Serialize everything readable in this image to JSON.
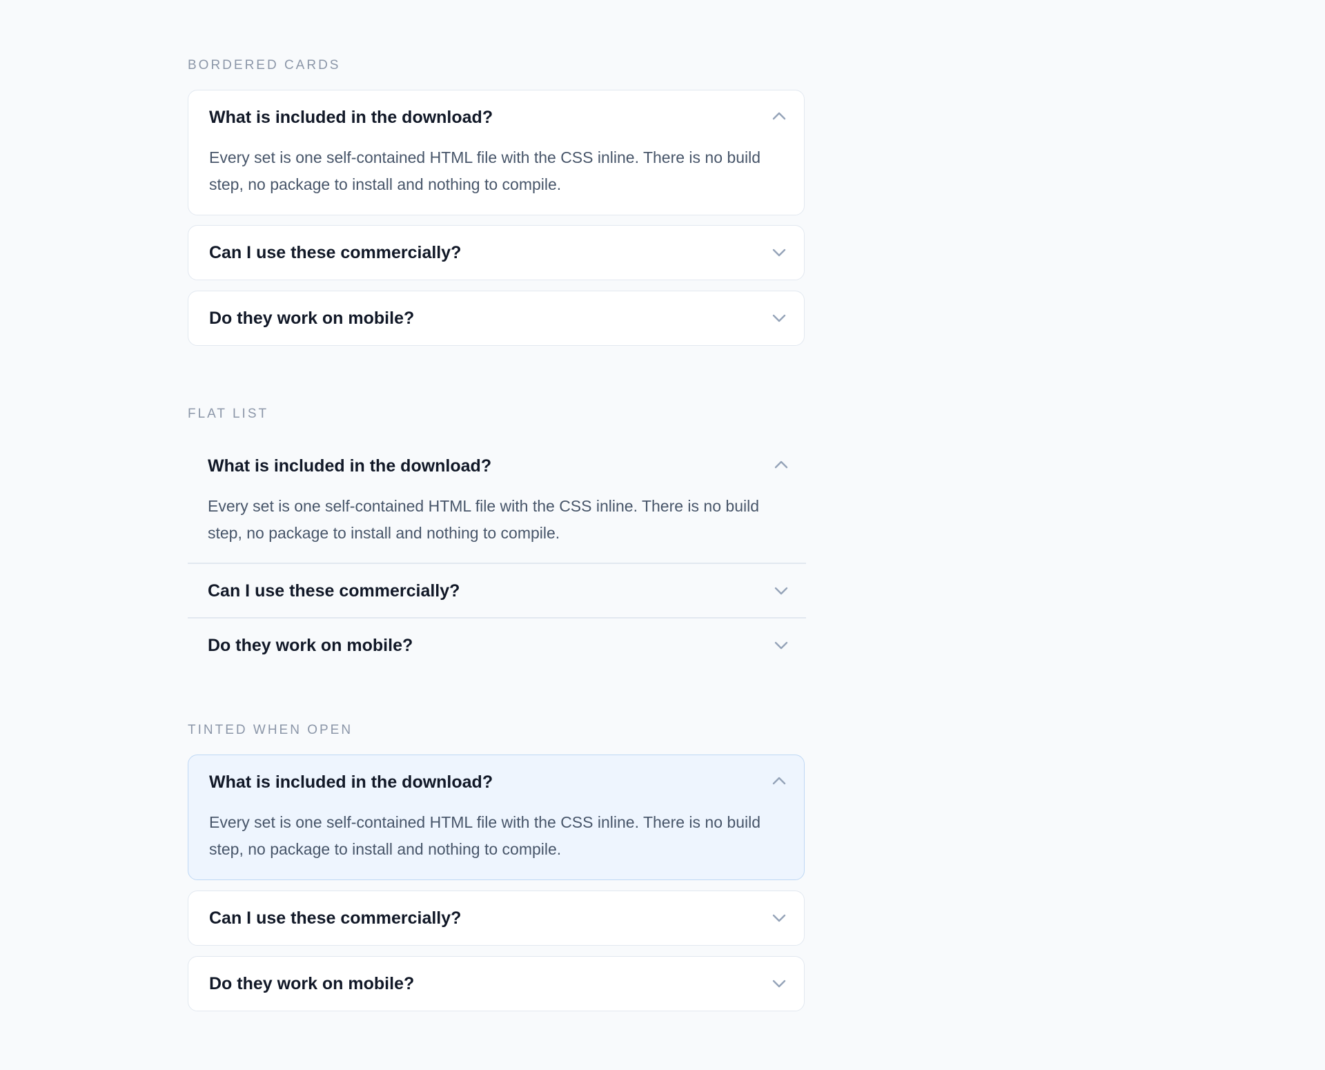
{
  "sections": [
    {
      "label": "BORDERED CARDS",
      "items": [
        {
          "question": "What is included in the download?",
          "answer": "Every set is one self-contained HTML file with the CSS inline. There is no build step, no package to install and nothing to compile.",
          "open": true
        },
        {
          "question": "Can I use these commercially?",
          "open": false
        },
        {
          "question": "Do they work on mobile?",
          "open": false
        }
      ]
    },
    {
      "label": "FLAT LIST",
      "items": [
        {
          "question": "What is included in the download?",
          "answer": "Every set is one self-contained HTML file with the CSS inline. There is no build step, no package to install and nothing to compile.",
          "open": true
        },
        {
          "question": "Can I use these commercially?",
          "open": false
        },
        {
          "question": "Do they work on mobile?",
          "open": false
        }
      ]
    },
    {
      "label": "TINTED WHEN OPEN",
      "items": [
        {
          "question": "What is included in the download?",
          "answer": "Every set is one self-contained HTML file with the CSS inline. There is no build step, no package to install and nothing to compile.",
          "open": true
        },
        {
          "question": "Can I use these commercially?",
          "open": false
        },
        {
          "question": "Do they work on mobile?",
          "open": false
        }
      ]
    }
  ],
  "colors": {
    "background": "#f8fafc",
    "card": "#ffffff",
    "tinted_card": "#eef5fe",
    "tinted_border": "#bfd8f4",
    "border": "#e2e8f0",
    "label": "#8b96a8",
    "question": "#111827",
    "answer": "#475569",
    "chevron": "#94a3b8"
  },
  "icons": {
    "open": "chevron-up-icon",
    "closed": "chevron-down-icon"
  }
}
